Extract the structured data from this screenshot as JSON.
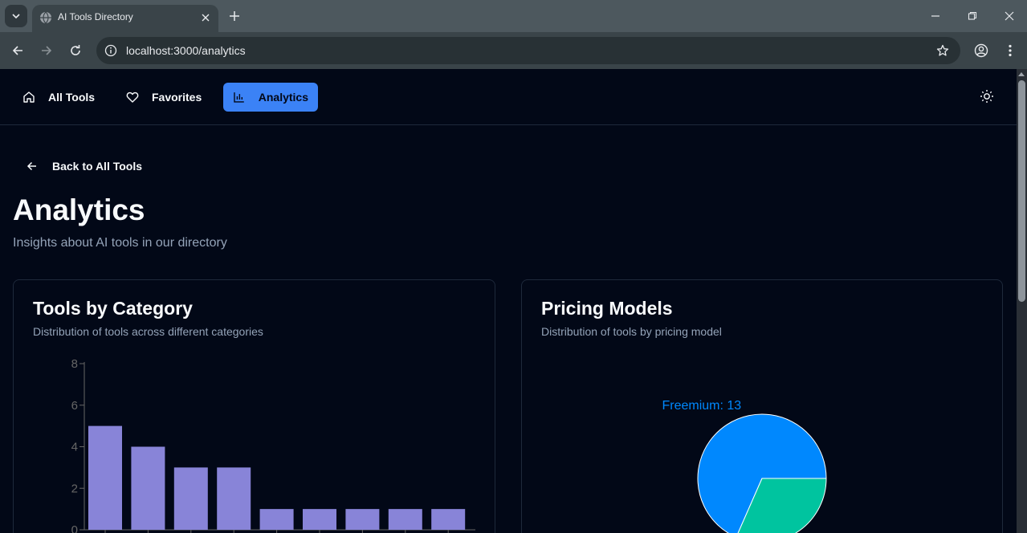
{
  "browser": {
    "tab_title": "AI Tools Directory",
    "url": "localhost:3000/analytics"
  },
  "nav": {
    "items": [
      {
        "label": "All Tools",
        "icon": "home-icon"
      },
      {
        "label": "Favorites",
        "icon": "heart-icon"
      },
      {
        "label": "Analytics",
        "icon": "bar-chart-icon",
        "active": true
      }
    ],
    "theme_icon": "sun-icon"
  },
  "page": {
    "back_label": "Back to All Tools",
    "title": "Analytics",
    "subtitle": "Insights about AI tools in our directory"
  },
  "cards": {
    "category": {
      "title": "Tools by Category",
      "description": "Distribution of tools across different categories"
    },
    "pricing": {
      "title": "Pricing Models",
      "description": "Distribution of tools by pricing model"
    }
  },
  "colors": {
    "accent": "#3b82f6",
    "bar": "#8884d8",
    "pie_freemium": "#0088fe",
    "pie_other": "#00c49f"
  },
  "chart_data": [
    {
      "type": "bar",
      "title": "Tools by Category",
      "categories": [],
      "values": [
        5,
        4,
        3,
        3,
        1,
        1,
        1,
        1,
        1
      ],
      "y_ticks": [
        "0",
        "2",
        "4",
        "6",
        "8"
      ],
      "ylim": [
        0,
        8
      ],
      "grid": false
    },
    {
      "type": "pie",
      "title": "Pricing Models",
      "slices": [
        {
          "label": "Freemium: 13",
          "value": 13
        },
        {
          "label": "",
          "value": 6
        }
      ]
    }
  ]
}
